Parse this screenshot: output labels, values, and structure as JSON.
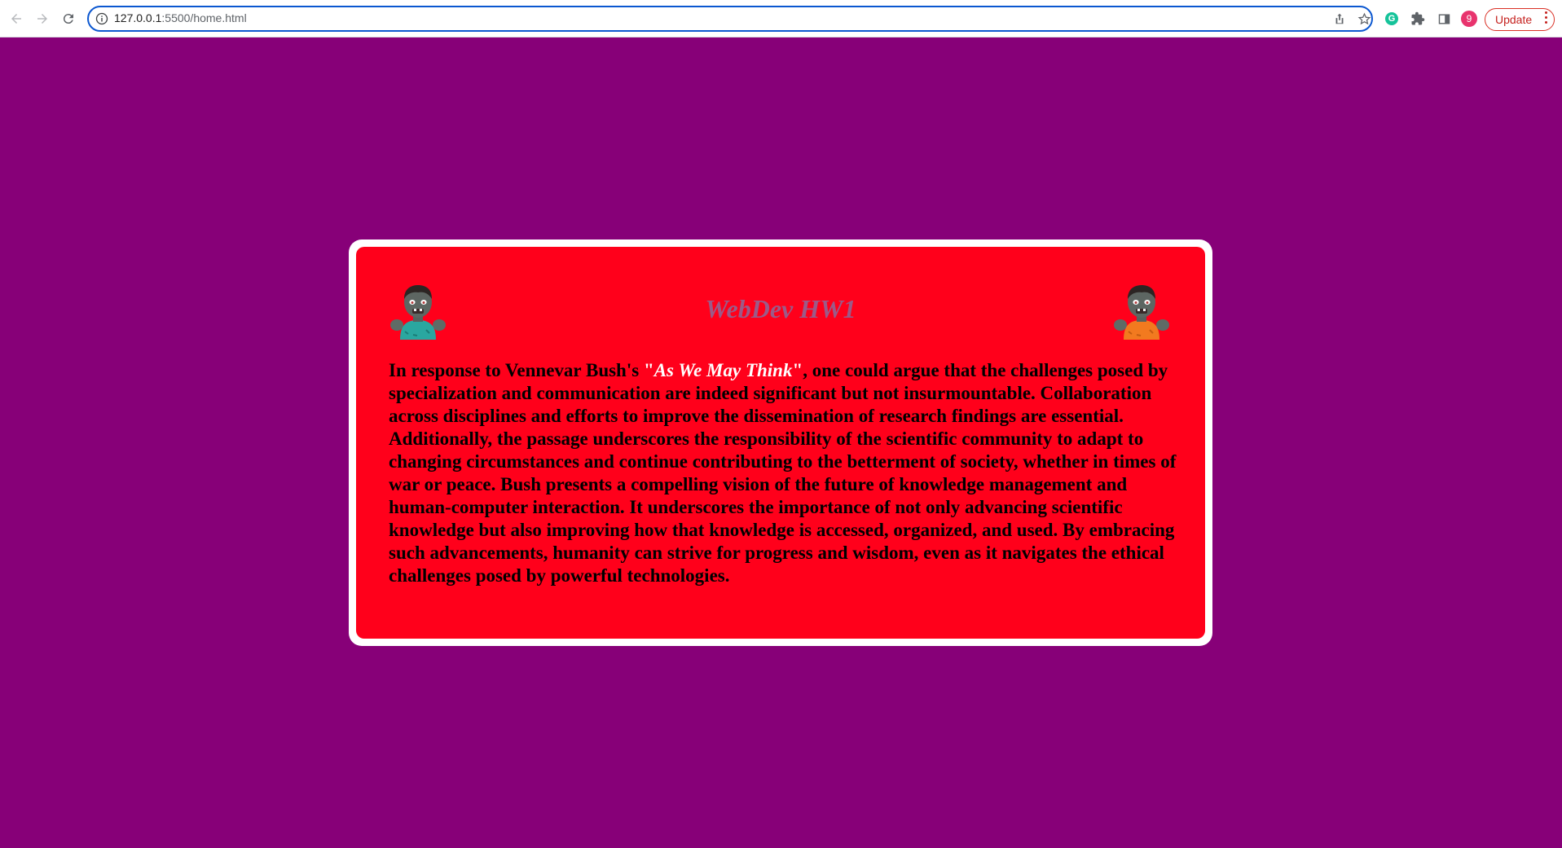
{
  "browser": {
    "url_host": "127.0.0.1",
    "url_rest": ":5500/home.html",
    "profile_initial": "9",
    "update_label": "Update",
    "icons": [
      "back-arrow-icon",
      "forward-arrow-icon",
      "reload-icon",
      "info-icon",
      "share-icon",
      "star-icon",
      "grammarly-icon",
      "extensions-puzzle-icon",
      "side-panel-icon",
      "more-vert-icon"
    ]
  },
  "page": {
    "background_color": "#870078",
    "card_border_color": "#ffffff",
    "card_color": "#ff001b",
    "title": "WebDev HW1",
    "title_color": "#9c5a88",
    "left_emoji": "zombie-teal-shirt",
    "right_emoji": "zombie-orange-shirt",
    "essay": {
      "intro": "In response to Vennevar Bush's ",
      "quote_open": "\"",
      "quote_title": "As We May Think",
      "quote_close": "\"",
      "body": ", one could argue that the challenges posed by specialization and communication are indeed significant but not insurmountable. Collaboration across disciplines and efforts to improve the dissemination of research findings are essential. Additionally, the passage underscores the responsibility of the scientific community to adapt to changing circumstances and continue contributing to the betterment of society, whether in times of war or peace. Bush presents a compelling vision of the future of knowledge management and human-computer interaction. It underscores the importance of not only advancing scientific knowledge but also improving how that knowledge is accessed, organized, and used. By embracing such advancements, humanity can strive for progress and wisdom, even as it navigates the ethical challenges posed by powerful technologies."
    }
  }
}
